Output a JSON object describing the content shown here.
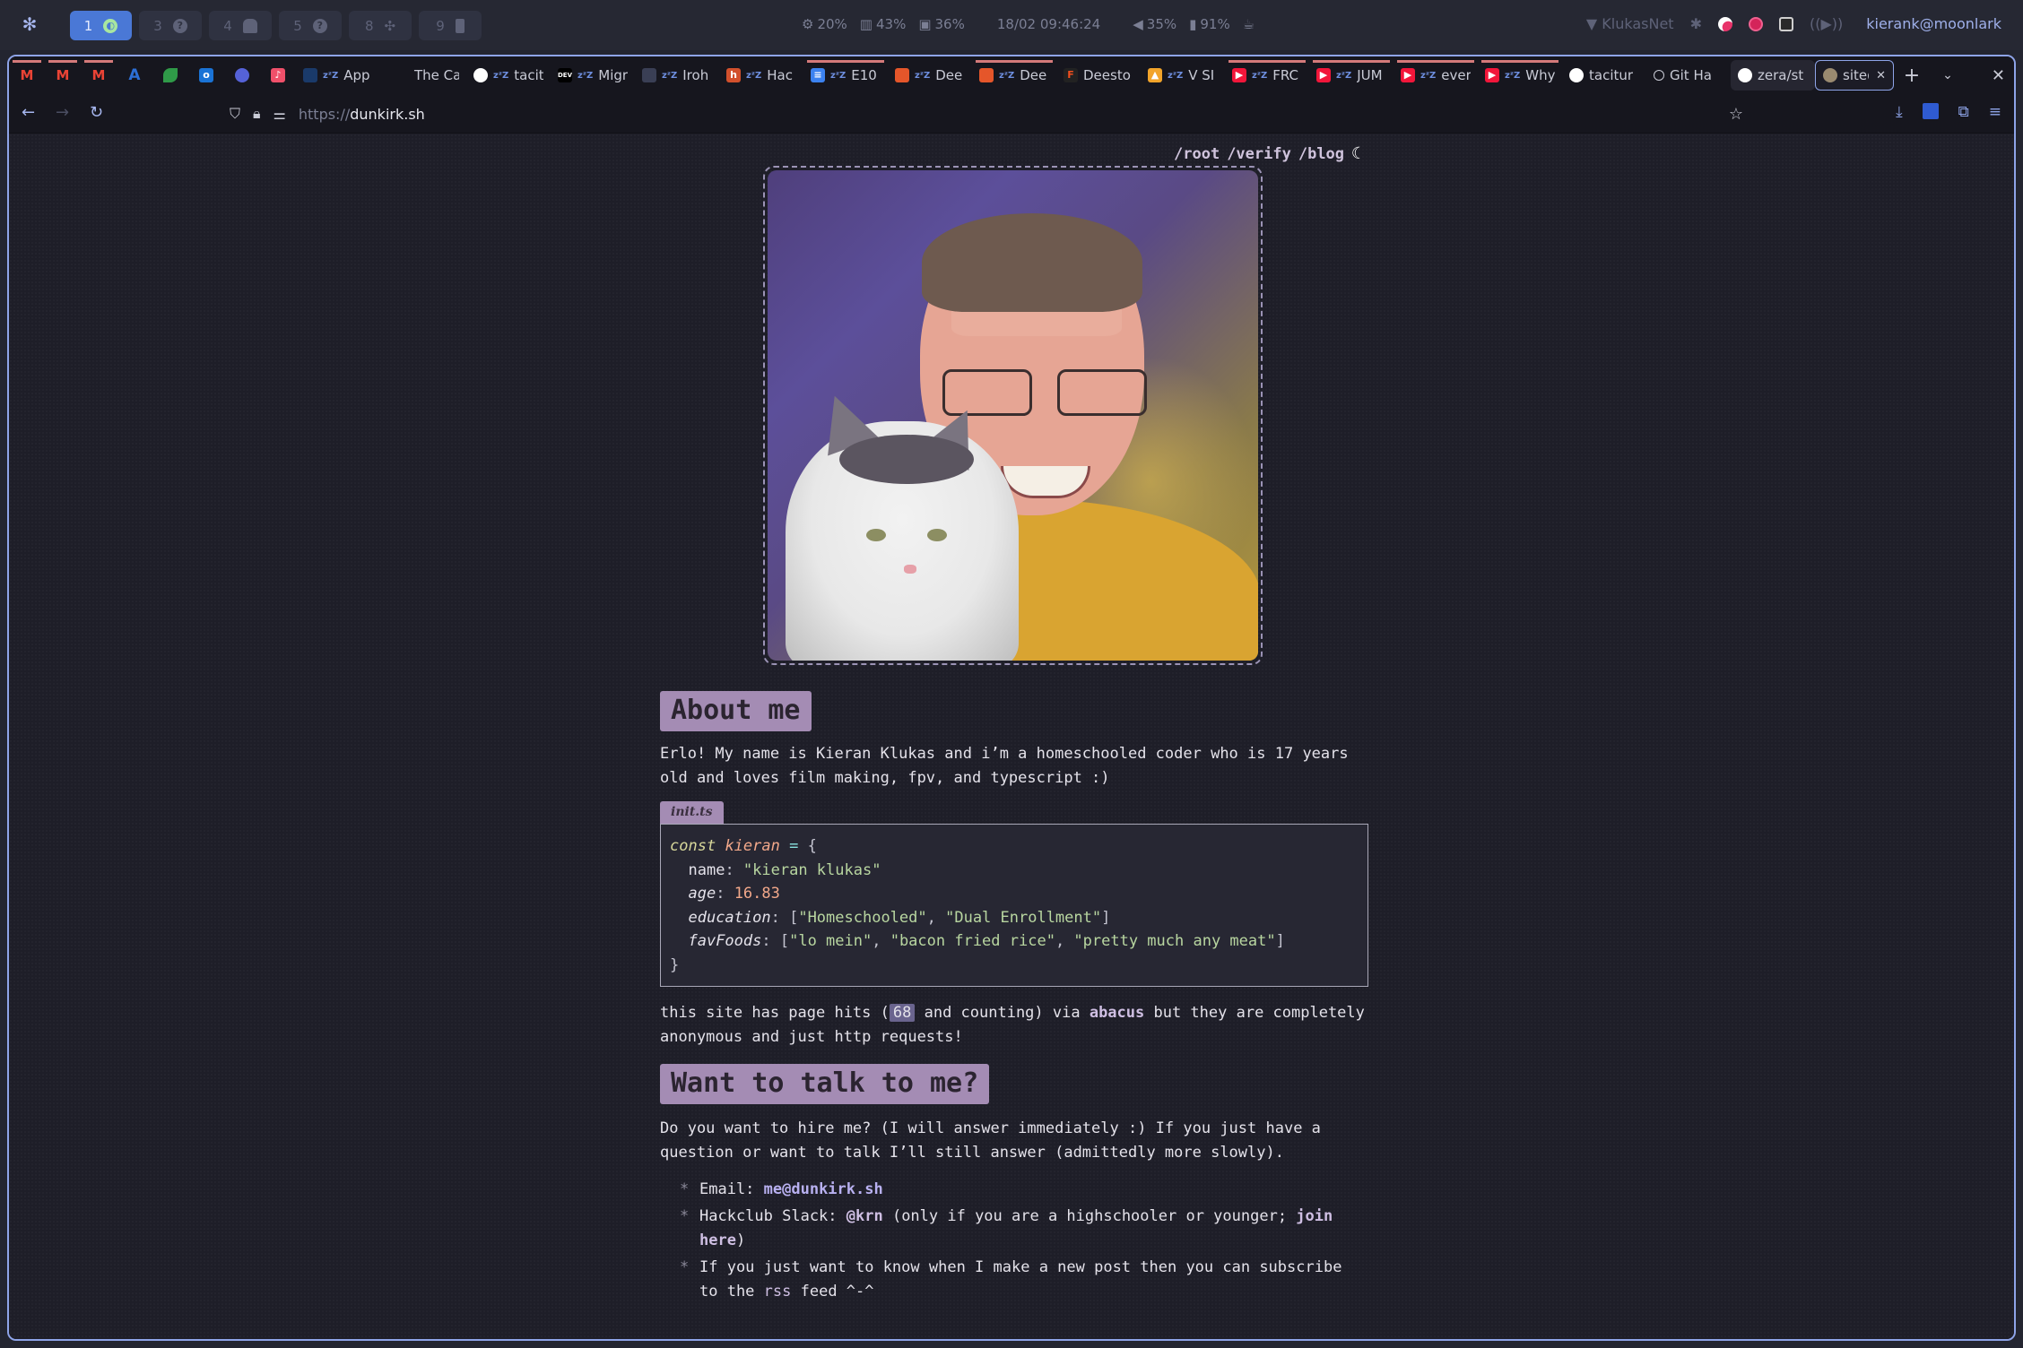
{
  "system_bar": {
    "launcher_icon": "gear-snowflake-icon",
    "workspaces": [
      {
        "number": "1",
        "icon": "circle-app-icon",
        "active": true
      },
      {
        "number": "3",
        "icon": "question-icon",
        "active": false
      },
      {
        "number": "4",
        "icon": "ghost-icon",
        "active": false
      },
      {
        "number": "5",
        "icon": "question-icon",
        "active": false
      },
      {
        "number": "8",
        "icon": "slack-icon",
        "active": false
      },
      {
        "number": "9",
        "icon": "phone-icon",
        "active": false
      }
    ],
    "cpu": "20%",
    "memory": "43%",
    "disk": "36%",
    "datetime": "18/02 09:46:24",
    "volume": "35%",
    "battery": "91%",
    "network": "KlukasNet",
    "user": "kierank@moonlark"
  },
  "browser": {
    "tabs": [
      {
        "label": "",
        "favicon": "gmail",
        "pinned": true,
        "loading": true
      },
      {
        "label": "",
        "favicon": "gmail",
        "pinned": true,
        "loading": true
      },
      {
        "label": "",
        "favicon": "gmail",
        "pinned": true,
        "loading": true
      },
      {
        "label": "",
        "favicon": "A",
        "pinned": true
      },
      {
        "label": "",
        "favicon": "leaf",
        "pinned": true
      },
      {
        "label": "",
        "favicon": "outlook",
        "pinned": true
      },
      {
        "label": "",
        "favicon": "app",
        "pinned": true
      },
      {
        "label": "",
        "favicon": "music",
        "pinned": true
      },
      {
        "label": "App",
        "sleeping": true
      },
      {
        "label": "The Ca"
      },
      {
        "label": "tacit",
        "sleeping": true,
        "favicon": "github"
      },
      {
        "label": "Migr",
        "sleeping": true,
        "favicon": "dev"
      },
      {
        "label": "Iroh",
        "sleeping": true
      },
      {
        "label": "Hac",
        "sleeping": true,
        "favicon": "h"
      },
      {
        "label": "E10",
        "sleeping": true,
        "favicon": "docs",
        "loading": true
      },
      {
        "label": "Dee",
        "sleeping": true
      },
      {
        "label": "Dee",
        "sleeping": true,
        "loading": true
      },
      {
        "label": "Deesto"
      },
      {
        "label": "V SI",
        "sleeping": true
      },
      {
        "label": "FRC",
        "sleeping": true,
        "favicon": "youtube",
        "loading": true
      },
      {
        "label": "JUM",
        "sleeping": true,
        "favicon": "youtube",
        "loading": true
      },
      {
        "label": "ever",
        "sleeping": true,
        "favicon": "youtube",
        "loading": true
      },
      {
        "label": "Why",
        "sleeping": true,
        "favicon": "youtube",
        "loading": true
      },
      {
        "label": "tacitur",
        "favicon": "github"
      },
      {
        "label": "Git Ha",
        "favicon": "speech"
      },
      {
        "label": "zera/st",
        "favicon": "github"
      },
      {
        "label": "site@",
        "favicon": "photo",
        "current": true
      }
    ],
    "url_scheme": "https://",
    "url_host": "dunkirk.sh"
  },
  "page": {
    "nav": [
      "/root",
      "/verify",
      "/blog"
    ],
    "about_heading": "About me",
    "about_text": "Erlo! My name is Kieran Klukas and i’m a homeschooled coder who is 17 years old and loves film making, fpv, and typescript :)",
    "code_filename": "init.ts",
    "code": {
      "keyword": "const",
      "var": "kieran",
      "op": "=",
      "fields": [
        {
          "key": "name",
          "italic": false,
          "value": "\"kieran klukas\"",
          "type": "string"
        },
        {
          "key": "age",
          "italic": true,
          "value": "16.83",
          "type": "number"
        },
        {
          "key": "education",
          "italic": true,
          "value": [
            "\"Homeschooled\"",
            "\"Dual Enrollment\""
          ],
          "type": "array"
        },
        {
          "key": "favFoods",
          "italic": true,
          "value": [
            "\"lo mein\"",
            "\"bacon fried rice\"",
            "\"pretty much any meat\""
          ],
          "type": "array"
        }
      ]
    },
    "hits_prefix": "this site has page hits (",
    "hits_count": "68",
    "hits_mid": " and counting) via ",
    "hits_link": "abacus",
    "hits_suffix": " but they are completely anonymous and just http requests!",
    "talk_heading": "Want to talk to me?",
    "talk_text": "Do you want to hire me? (I will answer immediately :) If you just have a question or want to talk I’ll still answer (admittedly more slowly).",
    "contacts": {
      "email_label": "Email: ",
      "email": "me@dunkirk.sh",
      "slack_label": "Hackclub Slack: ",
      "slack_handle": "@krn",
      "slack_note": " (only if you are a highschooler or younger; ",
      "slack_join": "join here",
      "slack_close": ")",
      "rss_prefix": "If you just want to know when I make a new post then you can subscribe to the ",
      "rss_link": "rss",
      "rss_suffix": " feed ^-^"
    }
  },
  "colors": {
    "accent": "#a48cb4",
    "window_border": "#8ea4e8",
    "workspace_active": "#4a78d6",
    "page_bg": "#1e1e28"
  }
}
